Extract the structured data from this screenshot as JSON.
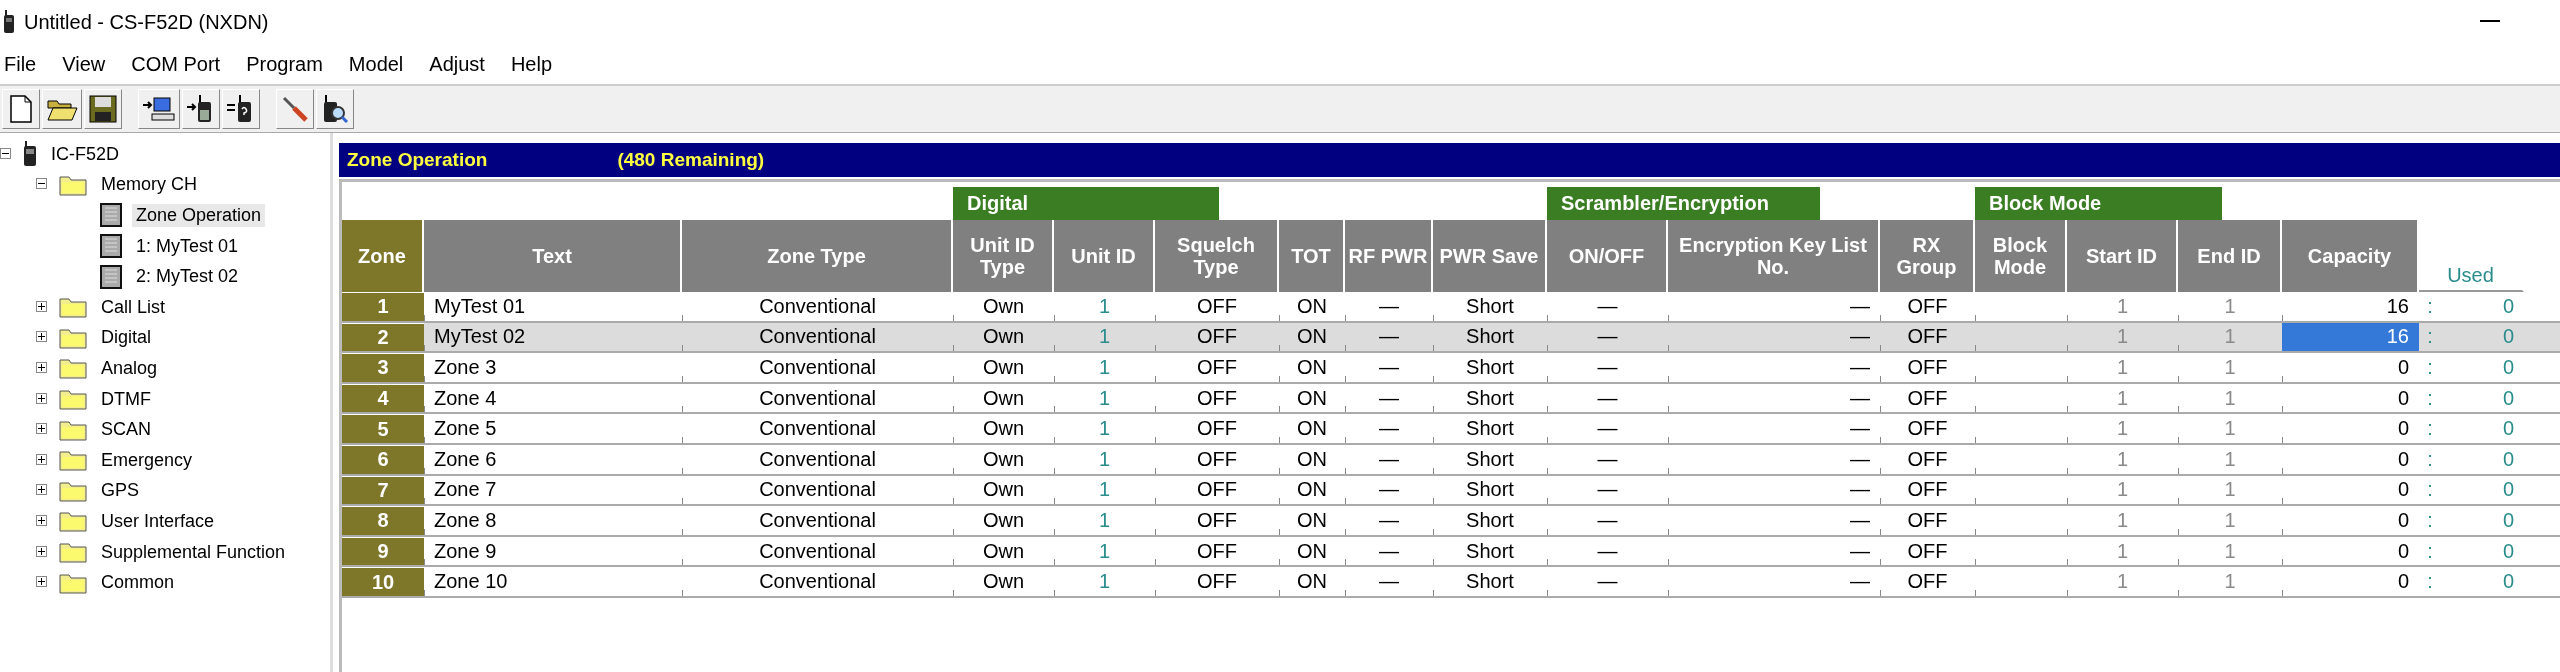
{
  "window": {
    "title": "Untitled - CS-F52D (NXDN)"
  },
  "menu": [
    "File",
    "View",
    "COM Port",
    "Program",
    "Model",
    "Adjust",
    "Help"
  ],
  "tree": {
    "label": "IC-F52D",
    "expanded": true,
    "children": [
      {
        "label": "Memory CH",
        "expanded": true,
        "children": [
          {
            "label": "Zone Operation",
            "selected": true
          },
          {
            "label": "1: MyTest 01",
            "selected": false
          },
          {
            "label": "2: MyTest 02",
            "selected": false
          }
        ]
      },
      {
        "label": "Call List",
        "expanded": false
      },
      {
        "label": "Digital",
        "expanded": false
      },
      {
        "label": "Analog",
        "expanded": false
      },
      {
        "label": "DTMF",
        "expanded": false
      },
      {
        "label": "SCAN",
        "expanded": false
      },
      {
        "label": "Emergency",
        "expanded": false
      },
      {
        "label": "GPS",
        "expanded": false
      },
      {
        "label": "User Interface",
        "expanded": false
      },
      {
        "label": "Supplemental Function",
        "expanded": false
      },
      {
        "label": "Common",
        "expanded": false
      }
    ]
  },
  "panel": {
    "title": "Zone Operation",
    "remaining": "(480 Remaining)"
  },
  "table": {
    "column_groups": [
      {
        "columns": [
          {
            "label": "Zone",
            "kind": "zone"
          },
          {
            "label": "Text",
            "kind": "text"
          },
          {
            "label": "Zone Type",
            "kind": "center"
          }
        ]
      },
      {
        "label": "Digital",
        "columns": [
          {
            "label": "Unit ID Type",
            "kind": "center"
          },
          {
            "label": "Unit ID",
            "kind": "teal"
          },
          {
            "label": "Squelch Type",
            "kind": "center"
          }
        ]
      },
      {
        "columns": [
          {
            "label": "TOT",
            "kind": "center"
          },
          {
            "label": "RF PWR",
            "kind": "center"
          },
          {
            "label": "PWR Save",
            "kind": "center"
          }
        ]
      },
      {
        "label": "Scrambler/Encryption",
        "columns": [
          {
            "label": "ON/OFF",
            "kind": "center"
          },
          {
            "label": "Encryption Key List No.",
            "kind": "right"
          }
        ]
      },
      {
        "columns": [
          {
            "label": "RX Group",
            "kind": "center"
          }
        ]
      },
      {
        "label": "Block Mode",
        "columns": [
          {
            "label": "Block Mode",
            "kind": "center"
          },
          {
            "label": "Start ID",
            "kind": "dim"
          },
          {
            "label": "End ID",
            "kind": "dim"
          }
        ]
      },
      {
        "columns": [
          {
            "label": "Capacity",
            "kind": "right"
          },
          {
            "label": "Used",
            "kind": "used"
          }
        ]
      }
    ],
    "rows": [
      {
        "selected": false,
        "capacity_selected": false,
        "cells": [
          "1",
          "MyTest 01",
          "Conventional",
          "Own",
          "1",
          "OFF",
          "ON",
          "—",
          "Short",
          "—",
          "—",
          "OFF",
          null,
          "1",
          "1",
          "16"
        ],
        "separator": ":",
        "used": "0"
      },
      {
        "selected": true,
        "capacity_selected": true,
        "cells": [
          "2",
          "MyTest 02",
          "Conventional",
          "Own",
          "1",
          "OFF",
          "ON",
          "—",
          "Short",
          "—",
          "—",
          "OFF",
          null,
          "1",
          "1",
          "16"
        ],
        "separator": ":",
        "used": "0"
      },
      {
        "selected": false,
        "capacity_selected": false,
        "cells": [
          "3",
          "Zone 3",
          "Conventional",
          "Own",
          "1",
          "OFF",
          "ON",
          "—",
          "Short",
          "—",
          "—",
          "OFF",
          null,
          "1",
          "1",
          "0"
        ],
        "separator": ":",
        "used": "0"
      },
      {
        "selected": false,
        "capacity_selected": false,
        "cells": [
          "4",
          "Zone 4",
          "Conventional",
          "Own",
          "1",
          "OFF",
          "ON",
          "—",
          "Short",
          "—",
          "—",
          "OFF",
          null,
          "1",
          "1",
          "0"
        ],
        "separator": ":",
        "used": "0"
      },
      {
        "selected": false,
        "capacity_selected": false,
        "cells": [
          "5",
          "Zone 5",
          "Conventional",
          "Own",
          "1",
          "OFF",
          "ON",
          "—",
          "Short",
          "—",
          "—",
          "OFF",
          null,
          "1",
          "1",
          "0"
        ],
        "separator": ":",
        "used": "0"
      },
      {
        "selected": false,
        "capacity_selected": false,
        "cells": [
          "6",
          "Zone 6",
          "Conventional",
          "Own",
          "1",
          "OFF",
          "ON",
          "—",
          "Short",
          "—",
          "—",
          "OFF",
          null,
          "1",
          "1",
          "0"
        ],
        "separator": ":",
        "used": "0"
      },
      {
        "selected": false,
        "capacity_selected": false,
        "cells": [
          "7",
          "Zone 7",
          "Conventional",
          "Own",
          "1",
          "OFF",
          "ON",
          "—",
          "Short",
          "—",
          "—",
          "OFF",
          null,
          "1",
          "1",
          "0"
        ],
        "separator": ":",
        "used": "0"
      },
      {
        "selected": false,
        "capacity_selected": false,
        "cells": [
          "8",
          "Zone 8",
          "Conventional",
          "Own",
          "1",
          "OFF",
          "ON",
          "—",
          "Short",
          "—",
          "—",
          "OFF",
          null,
          "1",
          "1",
          "0"
        ],
        "separator": ":",
        "used": "0"
      },
      {
        "selected": false,
        "capacity_selected": false,
        "cells": [
          "9",
          "Zone 9",
          "Conventional",
          "Own",
          "1",
          "OFF",
          "ON",
          "—",
          "Short",
          "—",
          "—",
          "OFF",
          null,
          "1",
          "1",
          "0"
        ],
        "separator": ":",
        "used": "0"
      },
      {
        "selected": false,
        "capacity_selected": false,
        "cells": [
          "10",
          "Zone 10",
          "Conventional",
          "Own",
          "1",
          "OFF",
          "ON",
          "—",
          "Short",
          "—",
          "—",
          "OFF",
          null,
          "1",
          "1",
          "0"
        ],
        "separator": ":",
        "used": "0"
      }
    ]
  }
}
